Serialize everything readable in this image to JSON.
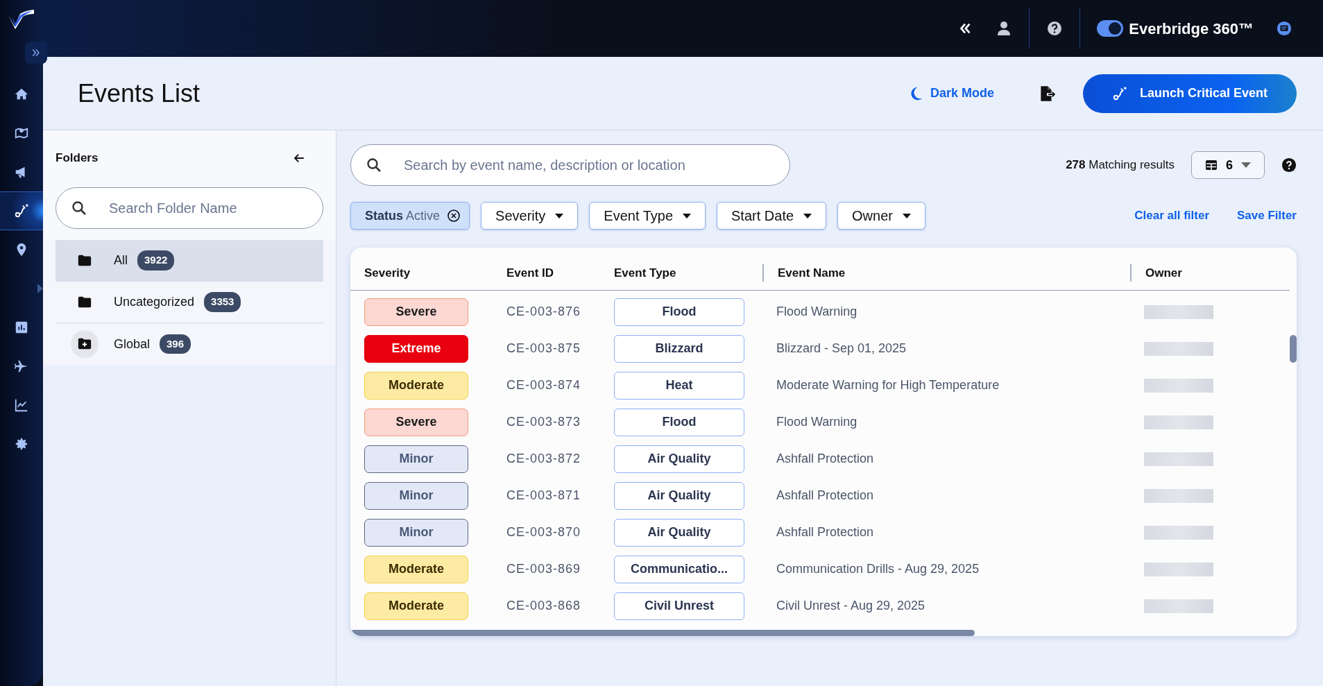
{
  "sidebar": {
    "items": [
      {
        "selected": false
      },
      {
        "selected": false
      },
      {
        "selected": false
      },
      {
        "selected": true
      },
      {
        "selected": false
      },
      {
        "selected": false
      },
      {
        "selected": false
      },
      {
        "selected": false
      },
      {
        "selected": false
      }
    ]
  },
  "top_bar": {
    "product_toggle_on": true,
    "product_name": "Everbridge 360™"
  },
  "header": {
    "title": "Events List",
    "dark_mode_label": "Dark Mode",
    "launch_button": "Launch Critical Event"
  },
  "folders": {
    "title": "Folders",
    "search": {
      "placeholder": "Search Folder Name"
    },
    "items": [
      {
        "label": "All",
        "count": "3922",
        "kind": "folder",
        "selected": true
      },
      {
        "label": "Uncategorized",
        "count": "3353",
        "kind": "folder",
        "selected": false
      },
      {
        "label": "Global",
        "count": "396",
        "kind": "folder-plus",
        "selected": false
      }
    ]
  },
  "events": {
    "search": {
      "placeholder": "Search by event name, description or location"
    },
    "results": "**278** Matching results",
    "columns_button": "6",
    "filters": [
      {
        "kind": "chip",
        "label": "Status",
        "value": "Active"
      },
      {
        "kind": "dropdown",
        "label": "Severity"
      },
      {
        "kind": "dropdown",
        "label": "Event Type"
      },
      {
        "kind": "dropdown",
        "label": "Start Date"
      },
      {
        "kind": "dropdown",
        "label": "Owner"
      }
    ],
    "filter_actions": [
      "Clear all filter",
      "Save Filter"
    ],
    "table": {
      "columns": [
        "Severity",
        "Event ID",
        "Event Type",
        "Event Name",
        "Owner"
      ],
      "rows": [
        {
          "severity": "Severe",
          "kind": "severe",
          "event_id": "CE-003-876",
          "event_type": "Flood",
          "event_name": "Flood Warning",
          "owner_redacted": true
        },
        {
          "severity": "Extreme",
          "kind": "extreme",
          "event_id": "CE-003-875",
          "event_type": "Blizzard",
          "event_name": "Blizzard - Sep 01, 2025",
          "owner_redacted": true
        },
        {
          "severity": "Moderate",
          "kind": "moderate",
          "event_id": "CE-003-874",
          "event_type": "Heat",
          "event_name": "Moderate Warning for High Temperature",
          "owner_redacted": true
        },
        {
          "severity": "Severe",
          "kind": "severe",
          "event_id": "CE-003-873",
          "event_type": "Flood",
          "event_name": "Flood Warning",
          "owner_redacted": true
        },
        {
          "severity": "Minor",
          "kind": "minor",
          "event_id": "CE-003-872",
          "event_type": "Air Quality",
          "event_name": "Ashfall Protection",
          "owner_redacted": true
        },
        {
          "severity": "Minor",
          "kind": "minor",
          "event_id": "CE-003-871",
          "event_type": "Air Quality",
          "event_name": "Ashfall Protection",
          "owner_redacted": true
        },
        {
          "severity": "Minor",
          "kind": "minor",
          "event_id": "CE-003-870",
          "event_type": "Air Quality",
          "event_name": "Ashfall Protection",
          "owner_redacted": true
        },
        {
          "severity": "Moderate",
          "kind": "moderate",
          "event_id": "CE-003-869",
          "event_type": "Communicatio...",
          "event_name": "Communication Drills - Aug 29, 2025",
          "owner_redacted": true
        },
        {
          "severity": "Moderate",
          "kind": "moderate",
          "event_id": "CE-003-868",
          "event_type": "Civil Unrest",
          "event_name": "Civil Unrest - Aug 29, 2025",
          "owner_redacted": true
        }
      ]
    }
  }
}
